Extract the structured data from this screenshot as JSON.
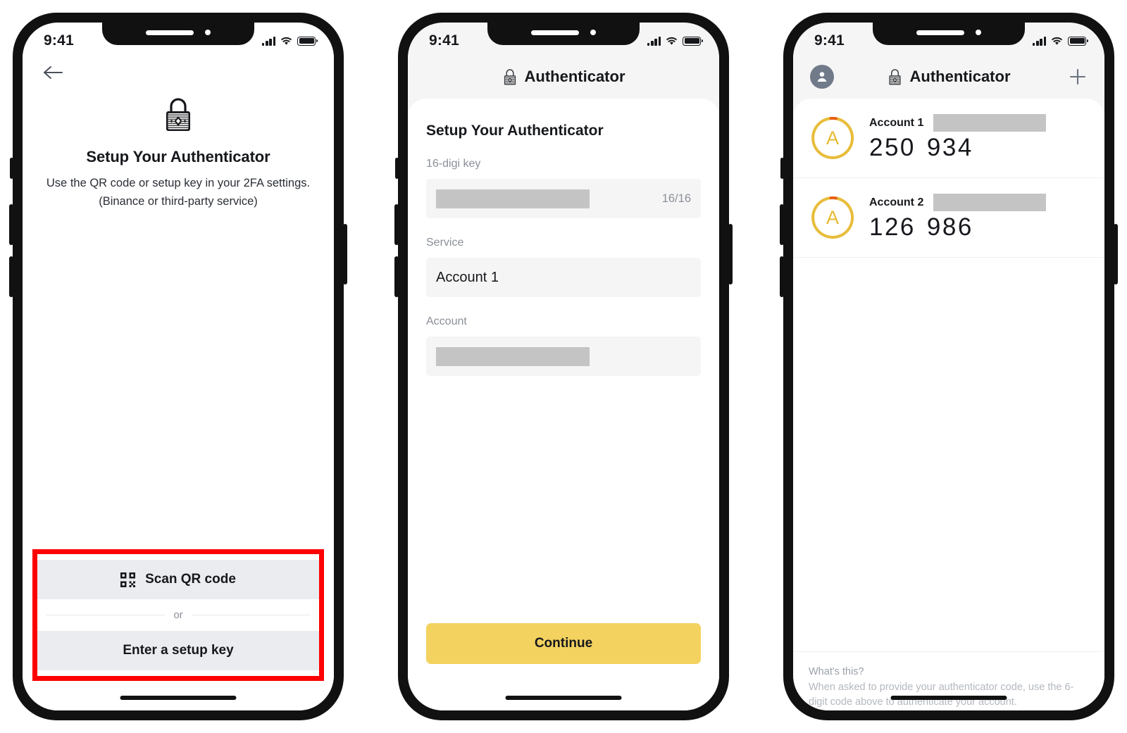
{
  "status_bar": {
    "time": "9:41",
    "icons": [
      "signal-icon",
      "wifi-icon",
      "battery-icon"
    ]
  },
  "screen1": {
    "name": "setup-intro",
    "back_icon": "back-arrow-icon",
    "hero_icon": "binance-padlock-icon",
    "title": "Setup Your Authenticator",
    "subtitle_line1": "Use the QR code or setup key in your 2FA settings.",
    "subtitle_line2": "(Binance or third-party service)",
    "scan_button": {
      "label": "Scan QR code",
      "icon": "qr-code-icon"
    },
    "divider_label": "or",
    "setup_key_button": {
      "label": "Enter a setup key"
    },
    "highlight_color": "#fd0000"
  },
  "screen2": {
    "name": "setup-form",
    "header": {
      "icon": "binance-padlock-icon",
      "title": "Authenticator"
    },
    "sheet_title": "Setup Your Authenticator",
    "fields": [
      {
        "label": "16-digi key",
        "value": "",
        "redacted": true,
        "counter": "16/16"
      },
      {
        "label": "Service",
        "value": "Account 1",
        "redacted": false,
        "counter": ""
      },
      {
        "label": "Account",
        "value": "",
        "redacted": true,
        "counter": ""
      }
    ],
    "continue_button": {
      "label": "Continue",
      "color": "#f3d25f"
    }
  },
  "screen3": {
    "name": "code-list",
    "header": {
      "avatar_icon": "person-avatar-icon",
      "icon": "binance-padlock-icon",
      "title": "Authenticator",
      "add_icon": "plus-icon"
    },
    "accounts": [
      {
        "avatar_letter": "A",
        "name": "Account 1",
        "email_redacted": true,
        "code_group1": "250",
        "code_group2": "934",
        "ring_progress_pct": 93,
        "ring_color": "#e8bd3a",
        "ring_tip_color": "#e8600e"
      },
      {
        "avatar_letter": "A",
        "name": "Account 2",
        "email_redacted": true,
        "code_group1": "126",
        "code_group2": "986",
        "ring_progress_pct": 93,
        "ring_color": "#e8bd3a",
        "ring_tip_color": "#e8600e"
      }
    ],
    "help": {
      "title": "What's this?",
      "body": "When asked to provide your authenticator code, use the 6-digit code above to authenticate your account."
    }
  }
}
